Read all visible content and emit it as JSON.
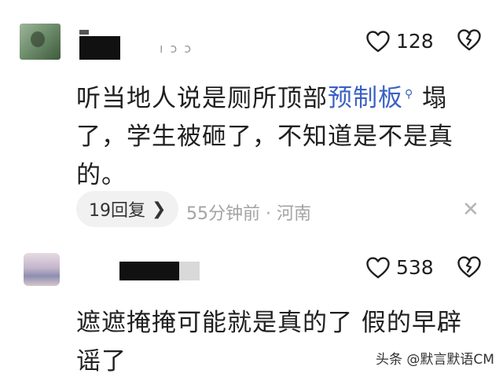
{
  "comments": [
    {
      "name_faint": "ı ɔ ɔ",
      "likes": "128",
      "text_before": "听当地人说是厕所顶部",
      "search_term": "预制板",
      "text_after": " 塌了，学生被砸了，不知道是不是真的。",
      "replies_label": "19回复",
      "meta": "55分钟前 · 河南"
    },
    {
      "likes": "538",
      "text": "遮遮掩掩可能就是真的了 假的早辟谣了"
    }
  ],
  "icons": {
    "like": "heart-outline-icon",
    "dislike": "broken-heart-icon",
    "search": "search-icon",
    "close": "close-icon",
    "chevron": "chevron-right-icon"
  },
  "watermark": "头条 @默言默语CM"
}
